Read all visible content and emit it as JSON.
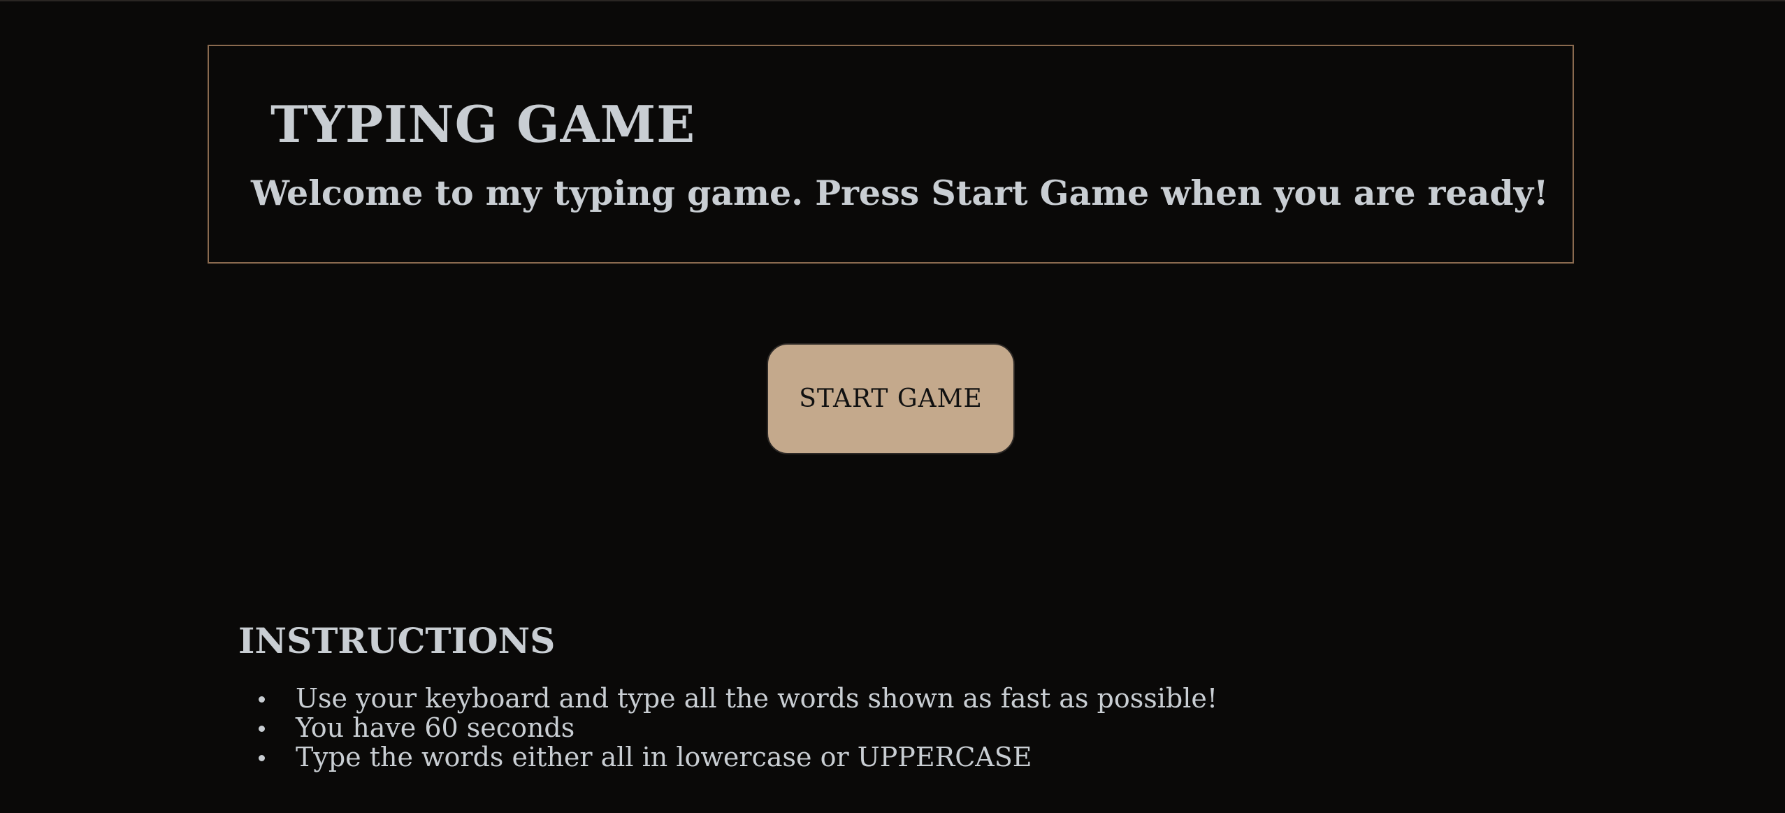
{
  "header": {
    "title": "TYPING GAME",
    "welcome": "Welcome to my typing game. Press Start Game when you are ready!"
  },
  "start_button": {
    "label": "START GAME"
  },
  "instructions": {
    "heading": "INSTRUCTIONS",
    "items": [
      "Use your keyboard and type all the words shown as fast as possible!",
      "You have 60 seconds",
      "Type the words either all in lowercase or UPPERCASE"
    ]
  },
  "colors": {
    "background": "#0a0908",
    "text": "#c9ced3",
    "border_accent": "#8a6a4f",
    "button_fill": "#c4a98c"
  }
}
